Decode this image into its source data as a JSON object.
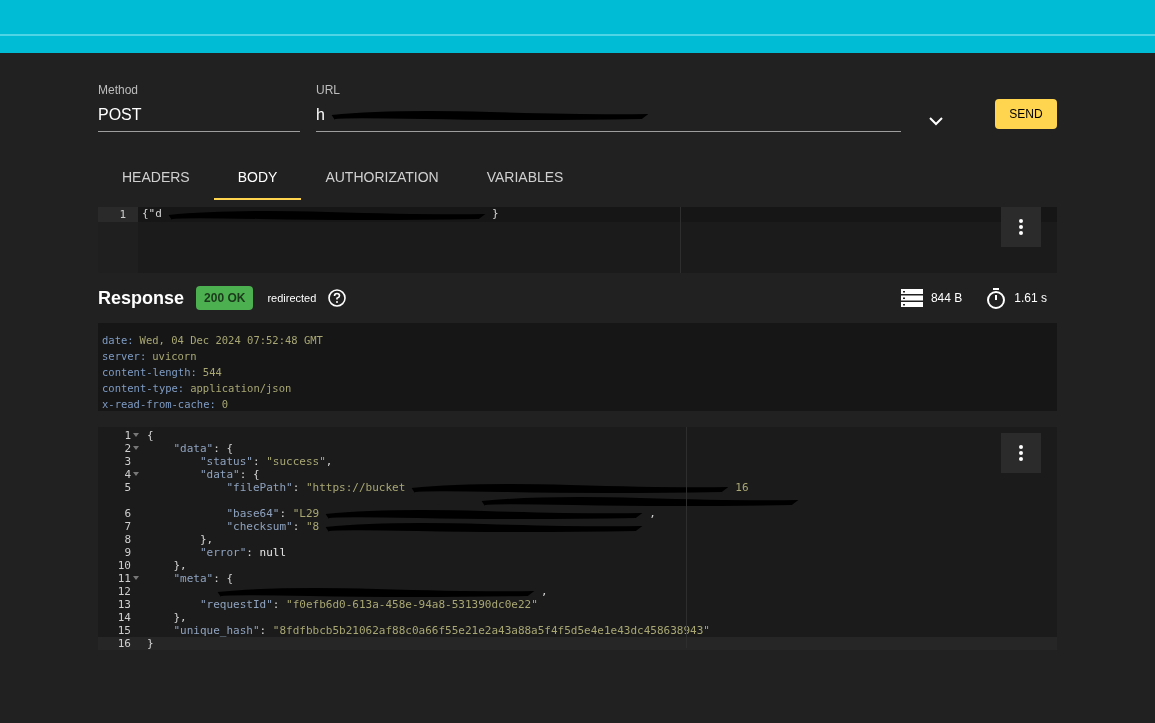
{
  "request": {
    "method": {
      "label": "Method",
      "value": "POST"
    },
    "url": {
      "label": "URL",
      "value": "h"
    },
    "send": "SEND"
  },
  "tabs": [
    {
      "label": "HEADERS",
      "selected": false
    },
    {
      "label": "BODY",
      "selected": true
    },
    {
      "label": "AUTHORIZATION",
      "selected": false
    },
    {
      "label": "VARIABLES",
      "selected": false
    }
  ],
  "body_editor": {
    "lines": [
      {
        "n": "1",
        "tokens": [
          {
            "kind": "punct",
            "text": "{\"d"
          },
          {
            "kind": "redaction"
          },
          {
            "kind": "punct",
            "text": "}"
          }
        ]
      }
    ]
  },
  "response": {
    "title": "Response",
    "status": "200 OK",
    "note": "redirected",
    "size": "844 B",
    "time": "1.61 s",
    "headers": [
      {
        "name": "date:",
        "value": "Wed, 04 Dec 2024 07:52:48 GMT"
      },
      {
        "name": "server:",
        "value": "uvicorn"
      },
      {
        "name": "content-length:",
        "value": "544"
      },
      {
        "name": "content-type:",
        "value": "application/json"
      },
      {
        "name": "x-read-from-cache:",
        "value": "0"
      }
    ],
    "lines": [
      {
        "n": "1",
        "fold": true,
        "tokens": [
          {
            "kind": "punct",
            "text": "{"
          }
        ]
      },
      {
        "n": "2",
        "fold": true,
        "tokens": [
          {
            "kind": "key",
            "text": "    \"data\""
          },
          {
            "kind": "punct",
            "text": ": {"
          }
        ]
      },
      {
        "n": "3",
        "fold": false,
        "tokens": [
          {
            "kind": "key",
            "text": "        \"status\""
          },
          {
            "kind": "punct",
            "text": ": "
          },
          {
            "kind": "string",
            "text": "\"success\""
          },
          {
            "kind": "punct",
            "text": ","
          }
        ]
      },
      {
        "n": "4",
        "fold": true,
        "tokens": [
          {
            "kind": "key",
            "text": "        \"data\""
          },
          {
            "kind": "punct",
            "text": ": {"
          }
        ]
      },
      {
        "n": "5",
        "fold": false,
        "tokens": [
          {
            "kind": "key",
            "text": "            \"filePath\""
          },
          {
            "kind": "punct",
            "text": ": "
          },
          {
            "kind": "string",
            "text": "\"https://bucket"
          },
          {
            "kind": "redaction"
          },
          {
            "kind": "string",
            "text": "16"
          }
        ],
        "continuation": [
          {
            "kind": "redaction"
          }
        ]
      },
      {
        "n": "6",
        "fold": false,
        "tokens": [
          {
            "kind": "key",
            "text": "            \"base64\""
          },
          {
            "kind": "punct",
            "text": ": "
          },
          {
            "kind": "string",
            "text": "\"L29"
          },
          {
            "kind": "redaction"
          },
          {
            "kind": "punct",
            "text": ","
          }
        ]
      },
      {
        "n": "7",
        "fold": false,
        "tokens": [
          {
            "kind": "key",
            "text": "            \"checksum\""
          },
          {
            "kind": "punct",
            "text": ": "
          },
          {
            "kind": "string",
            "text": "\"8"
          },
          {
            "kind": "redaction"
          }
        ]
      },
      {
        "n": "8",
        "fold": false,
        "tokens": [
          {
            "kind": "punct",
            "text": "        },"
          }
        ]
      },
      {
        "n": "9",
        "fold": false,
        "tokens": [
          {
            "kind": "key",
            "text": "        \"error\""
          },
          {
            "kind": "punct",
            "text": ": "
          },
          {
            "kind": "null",
            "text": "null"
          }
        ]
      },
      {
        "n": "10",
        "fold": false,
        "tokens": [
          {
            "kind": "punct",
            "text": "    },"
          }
        ]
      },
      {
        "n": "11",
        "fold": true,
        "tokens": [
          {
            "kind": "key",
            "text": "    \"meta\""
          },
          {
            "kind": "punct",
            "text": ": {"
          }
        ]
      },
      {
        "n": "12",
        "fold": false,
        "tokens": [
          {
            "kind": "redaction"
          },
          {
            "kind": "punct",
            "text": ","
          }
        ]
      },
      {
        "n": "13",
        "fold": false,
        "tokens": [
          {
            "kind": "key",
            "text": "        \"requestId\""
          },
          {
            "kind": "punct",
            "text": ": "
          },
          {
            "kind": "string",
            "text": "\"f0efb6d0-613a-458e-94a8-531390dc0e22\""
          }
        ]
      },
      {
        "n": "14",
        "fold": false,
        "tokens": [
          {
            "kind": "punct",
            "text": "    },"
          }
        ]
      },
      {
        "n": "15",
        "fold": false,
        "tokens": [
          {
            "kind": "key",
            "text": "    \"unique_hash\""
          },
          {
            "kind": "punct",
            "text": ": "
          },
          {
            "kind": "string",
            "text": "\"8fdfbbcb5b21062af88c0a66f55e21e2a43a88a5f4f5d5e4e1e43dc458638943\""
          }
        ]
      },
      {
        "n": "16",
        "fold": false,
        "tokens": [
          {
            "kind": "punct",
            "text": "}"
          }
        ]
      }
    ]
  }
}
